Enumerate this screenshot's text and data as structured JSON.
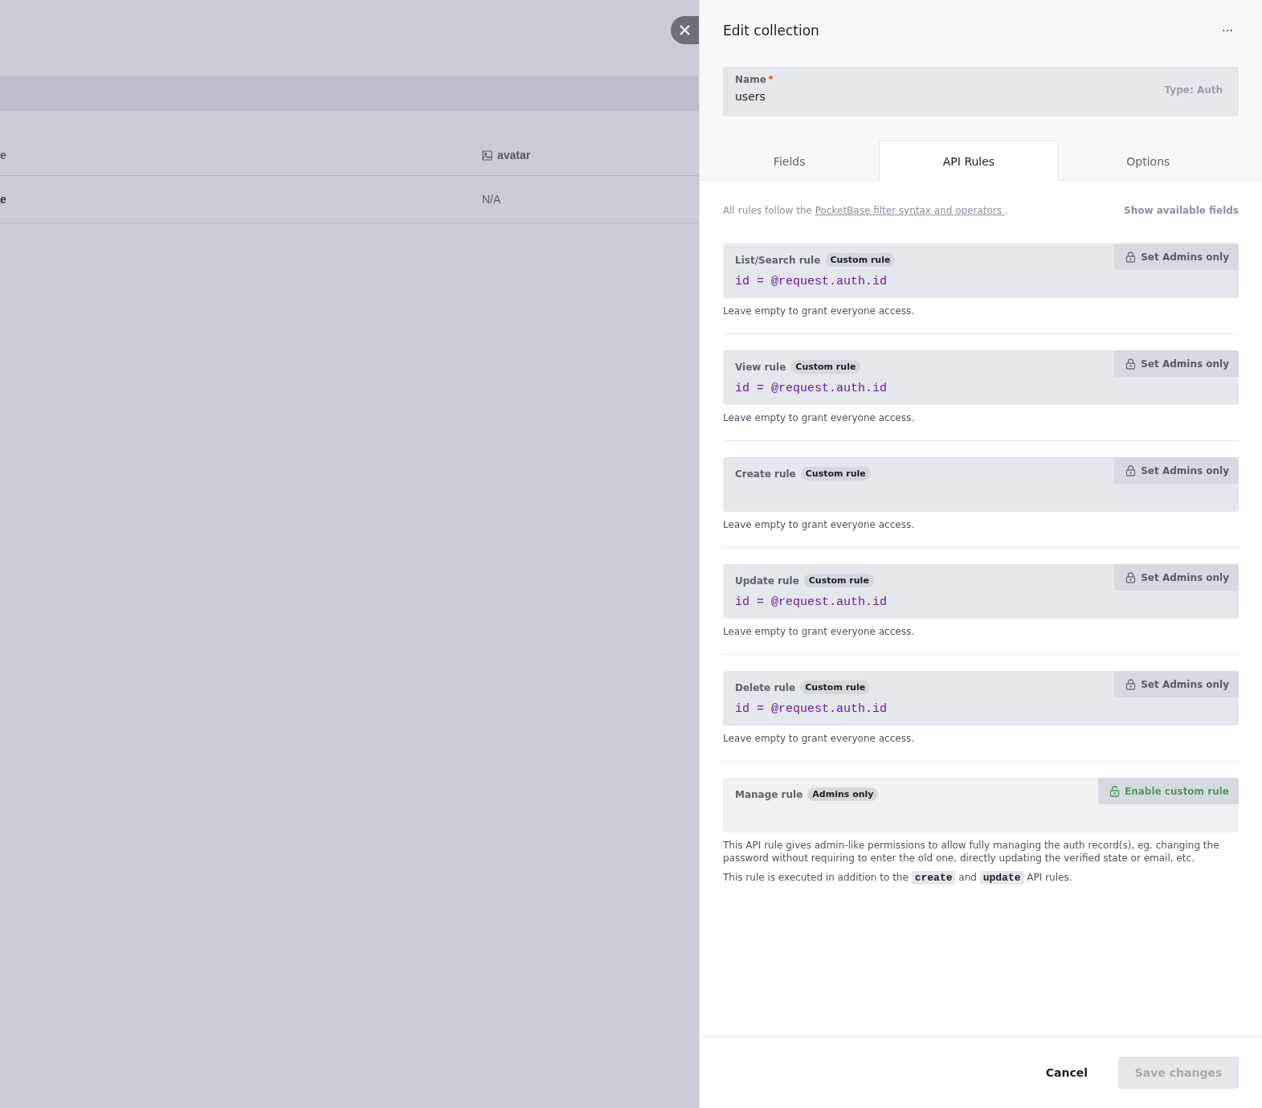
{
  "background": {
    "table": {
      "columns": [
        "e",
        "avatar"
      ],
      "rows": [
        [
          "e",
          "N/A"
        ]
      ]
    }
  },
  "panel": {
    "title": "Edit collection",
    "more_icon": "⋯",
    "name_field": {
      "label": "Name",
      "required": true,
      "required_mark": "*",
      "value": "users",
      "type_hint": "Type: Auth"
    },
    "tabs": [
      {
        "label": "Fields",
        "selected": false
      },
      {
        "label": "API Rules",
        "selected": true
      },
      {
        "label": "Options",
        "selected": false
      }
    ],
    "intro": {
      "text": "All rules follow the",
      "link": "PocketBase filter syntax and operators",
      "end": "."
    },
    "show_fields": "Show available fields",
    "rules": [
      {
        "label": "List/Search rule",
        "kind": "custom",
        "badge": "Custom rule",
        "value": "id = @request.auth.id",
        "action": "Set Admins only",
        "hint": "Leave empty to grant everyone access."
      },
      {
        "label": "View rule",
        "kind": "custom",
        "badge": "Custom rule",
        "value": "id = @request.auth.id",
        "action": "Set Admins only",
        "hint": "Leave empty to grant everyone access."
      },
      {
        "label": "Create rule",
        "kind": "custom",
        "badge": "Custom rule",
        "action": "Set Admins only",
        "hint": "Leave empty to grant everyone access."
      },
      {
        "label": "Update rule",
        "kind": "custom",
        "badge": "Custom rule",
        "value": "id = @request.auth.id",
        "action": "Set Admins only",
        "hint": "Leave empty to grant everyone access."
      },
      {
        "label": "Delete rule",
        "kind": "custom",
        "badge": "Custom rule",
        "value": "id = @request.auth.id",
        "action": "Set Admins only",
        "hint": "Leave empty to grant everyone access."
      },
      {
        "label": "Manage rule",
        "kind": "admins",
        "badge": "Admins only",
        "action": "Enable custom rule",
        "hints": [
          "This API rule gives admin-like permissions to allow fully managing the auth record(s), eg. changing the password without requiring to enter the old one, directly updating the verified state or email, etc.",
          [
            {
              "text": "This rule is executed in addition to the "
            },
            {
              "code": "create"
            },
            {
              "text": " and "
            },
            {
              "code": "update"
            },
            {
              "text": " API rules."
            }
          ]
        ]
      }
    ],
    "footer": {
      "cancel": "Cancel",
      "save": {
        "label": "Save changes",
        "disabled": true
      }
    }
  }
}
